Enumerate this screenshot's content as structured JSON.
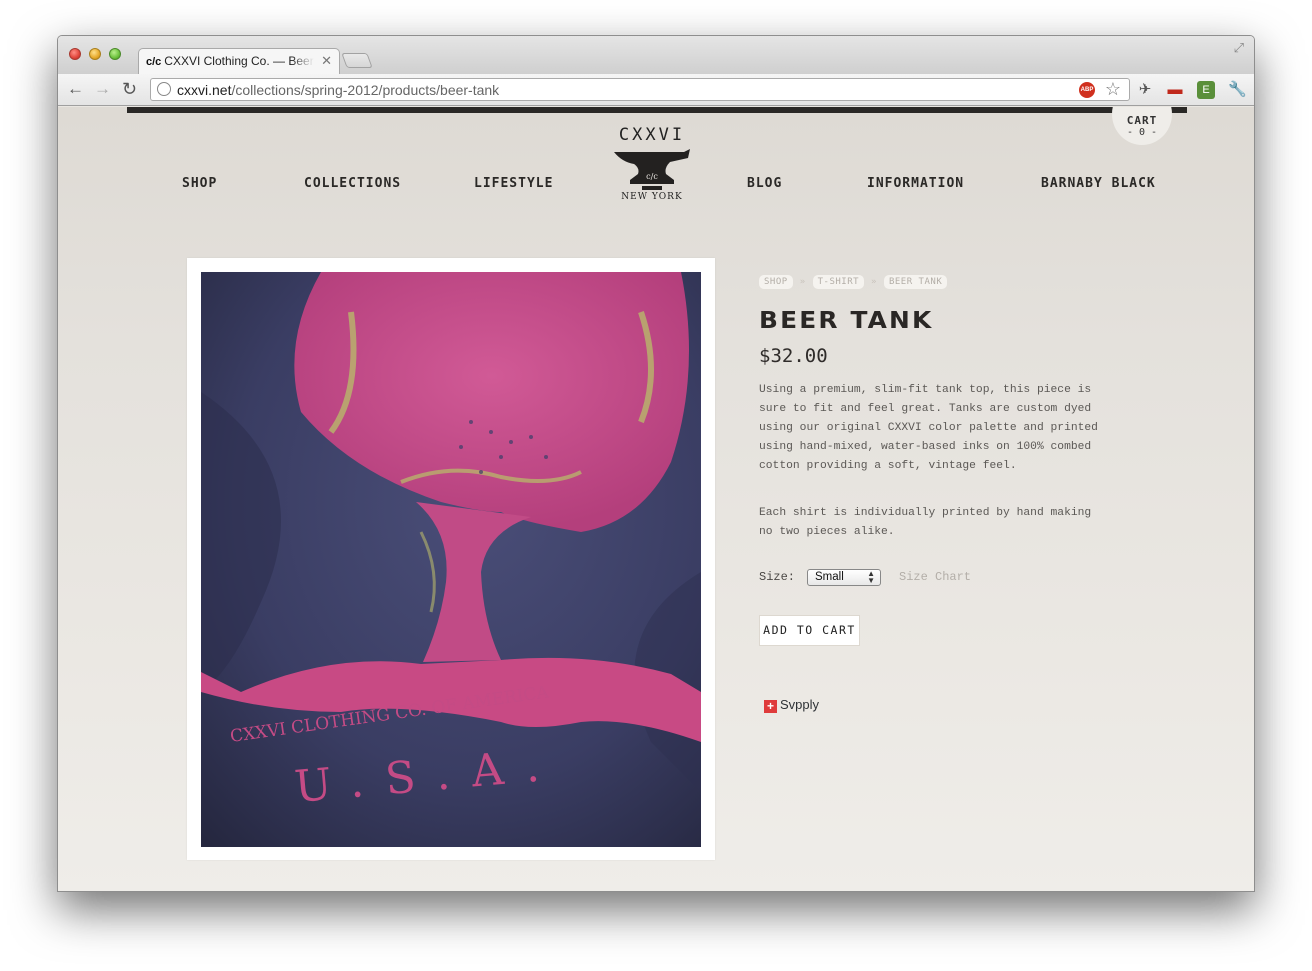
{
  "browser": {
    "tab_title": "CXXVI Clothing Co. — Beer Tank",
    "tab_favicon": "c/c",
    "url_host": "cxxvi.net",
    "url_path": "/collections/spring-2012/products/beer-tank",
    "icons": [
      "back-arrow-icon",
      "forward-arrow-icon",
      "reload-icon",
      "globe-icon",
      "adblock-icon",
      "star-icon",
      "sync-icon",
      "couch-icon",
      "evernote-icon",
      "wrench-icon"
    ]
  },
  "site": {
    "cart_label": "CART",
    "cart_count": "- 0 -",
    "nav": {
      "shop": "SHOP",
      "collections": "COLLECTIONS",
      "lifestyle": "LIFESTYLE",
      "blog": "BLOG",
      "information": "INFORMATION",
      "barnaby_black": "BARNABY BLACK"
    },
    "logo": {
      "top": "CXXVI",
      "middle": "c/c",
      "bottom": "NEW YORK"
    }
  },
  "product": {
    "breadcrumbs": [
      "SHOP",
      "T-SHIRT",
      "BEER TANK"
    ],
    "breadcrumb_separator": "»",
    "title": "BEER TANK",
    "price": "$32.00",
    "description_1": "Using a premium, slim-fit tank top, this piece is sure to fit and feel great. Tanks are custom dyed using our original CXXVI color palette and printed using hand-mixed, water-based inks on 100% combed cotton providing a soft, vintage feel.",
    "description_2": "Each shirt is individually printed by hand making no two pieces alike.",
    "size_label": "Size:",
    "size_selected": "Small",
    "size_chart_link": "Size Chart",
    "add_to_cart": "ADD TO CART",
    "svpply": "Svpply",
    "image_print_text": "CXXVI CLOTHING CO. OF AMERICA",
    "image_print_usa": "U.S.A."
  },
  "colors": {
    "page_bg": "#e6e2dd",
    "ink": "#2a2725",
    "shirt": "#3b3f66",
    "print_pink": "#c8447a",
    "print_gold": "#b9b36a"
  }
}
